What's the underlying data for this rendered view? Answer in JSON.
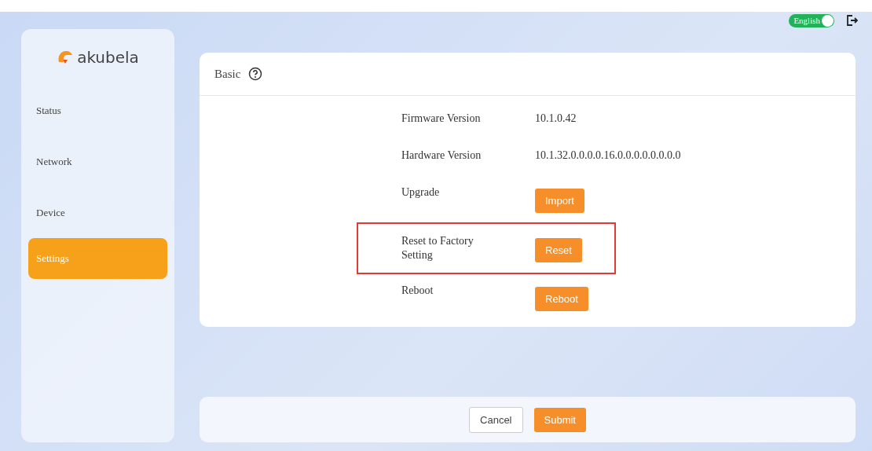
{
  "logo": {
    "text": "akubela"
  },
  "language_switch": {
    "label": "English",
    "on": true
  },
  "sidebar": {
    "items": [
      {
        "label": "Status",
        "selected": false
      },
      {
        "label": "Network",
        "selected": false
      },
      {
        "label": "Device",
        "selected": false
      },
      {
        "label": "Settings",
        "selected": true
      }
    ]
  },
  "panel": {
    "title": "Basic",
    "rows": [
      {
        "kind": "text",
        "label": "Firmware Version",
        "value": "10.1.0.42",
        "highlighted": false
      },
      {
        "kind": "text",
        "label": "Hardware Version",
        "value": "10.1.32.0.0.0.0.16.0.0.0.0.0.0.0.0",
        "highlighted": false
      },
      {
        "kind": "button",
        "label": "Upgrade",
        "value": "Import",
        "highlighted": false
      },
      {
        "kind": "button",
        "label": "Reset to Factory Setting",
        "value": "Reset",
        "highlighted": true
      },
      {
        "kind": "button",
        "label": "Reboot",
        "value": "Reboot",
        "highlighted": false
      }
    ]
  },
  "footer": {
    "buttons": [
      {
        "label": "Cancel",
        "kind": "secondary"
      },
      {
        "label": "Submit",
        "kind": "primary"
      }
    ]
  }
}
